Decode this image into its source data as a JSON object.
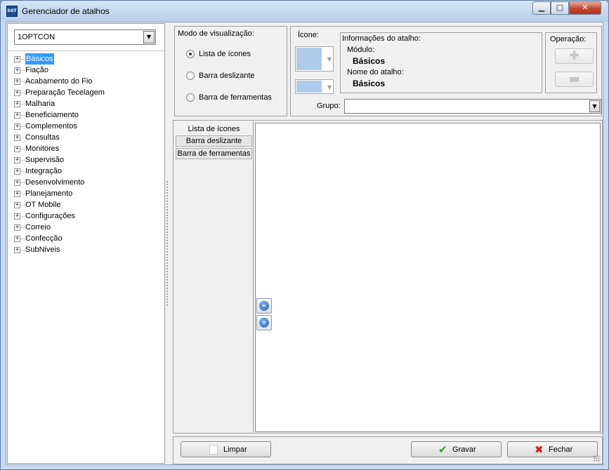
{
  "window": {
    "title": "Gerenciador de atalhos",
    "app_icon_text": "SGT",
    "minimize": "▁",
    "maximize": "□",
    "close": "✕"
  },
  "left_panel": {
    "combo_value": "1OPTCON",
    "combo_arrow": "▼",
    "expander_glyph": "+",
    "tree_items": [
      {
        "label": "Básicos",
        "selected": true
      },
      {
        "label": "Fiação"
      },
      {
        "label": "Acabamento do Fio"
      },
      {
        "label": "Preparação  Tecelagem"
      },
      {
        "label": "Malharia"
      },
      {
        "label": "Beneficiamento"
      },
      {
        "label": "Complementos"
      },
      {
        "label": "Consultas"
      },
      {
        "label": "Monitores"
      },
      {
        "label": "Supervisão"
      },
      {
        "label": "Integração"
      },
      {
        "label": "Desenvolvimento"
      },
      {
        "label": "Planejamento"
      },
      {
        "label": "OT Mobile"
      },
      {
        "label": "Configurações"
      },
      {
        "label": "Correio"
      },
      {
        "label": "Confecção"
      },
      {
        "label": "SubNiveis"
      }
    ]
  },
  "view_mode": {
    "title": "Modo de visualização:",
    "options": [
      {
        "label": "Lista de ícones",
        "checked": true
      },
      {
        "label": "Barra deslizante",
        "checked": false
      },
      {
        "label": "Barra de ferramentas",
        "checked": false
      }
    ]
  },
  "shortcut": {
    "icone_label": "Ícone:",
    "picker_arrow": "▼",
    "info_title": "Informações do atalho:",
    "modulo_label": "Módulo:",
    "modulo_value": "Básicos",
    "nome_label": "Nome do atalho:",
    "nome_value": "Básicos",
    "operacao_title": "Operação:",
    "add_glyph": "✚",
    "remove_glyph": "▬",
    "grupo_label": "Grupo:",
    "grupo_value": "",
    "grupo_arrow": "▼"
  },
  "tabs": [
    {
      "label": "Lista de ícones",
      "active": true
    },
    {
      "label": "Barra deslizante",
      "active": false
    },
    {
      "label": "Barra de ferramentas",
      "active": false
    }
  ],
  "move_buttons": {
    "left_glyph": "«",
    "right_glyph": "»"
  },
  "buttons": {
    "limpar": "Limpar",
    "gravar": "Gravar",
    "gravar_icon": "✔",
    "fechar": "Fechar",
    "fechar_icon": "✖"
  }
}
